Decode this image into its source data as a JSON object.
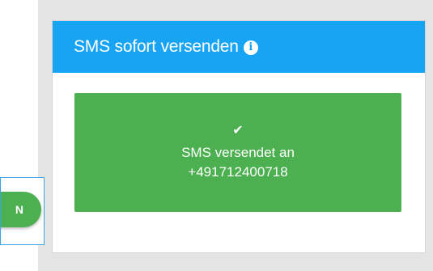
{
  "card": {
    "header_title": "SMS sofort versenden",
    "info_icon": "info-icon",
    "header_color": "#17a4f4"
  },
  "success": {
    "icon": "checkmark-icon",
    "line1": "SMS versendet an",
    "line2": "+491712400718",
    "color": "#4caf50"
  },
  "partial_button": {
    "label_fragment": "N"
  }
}
